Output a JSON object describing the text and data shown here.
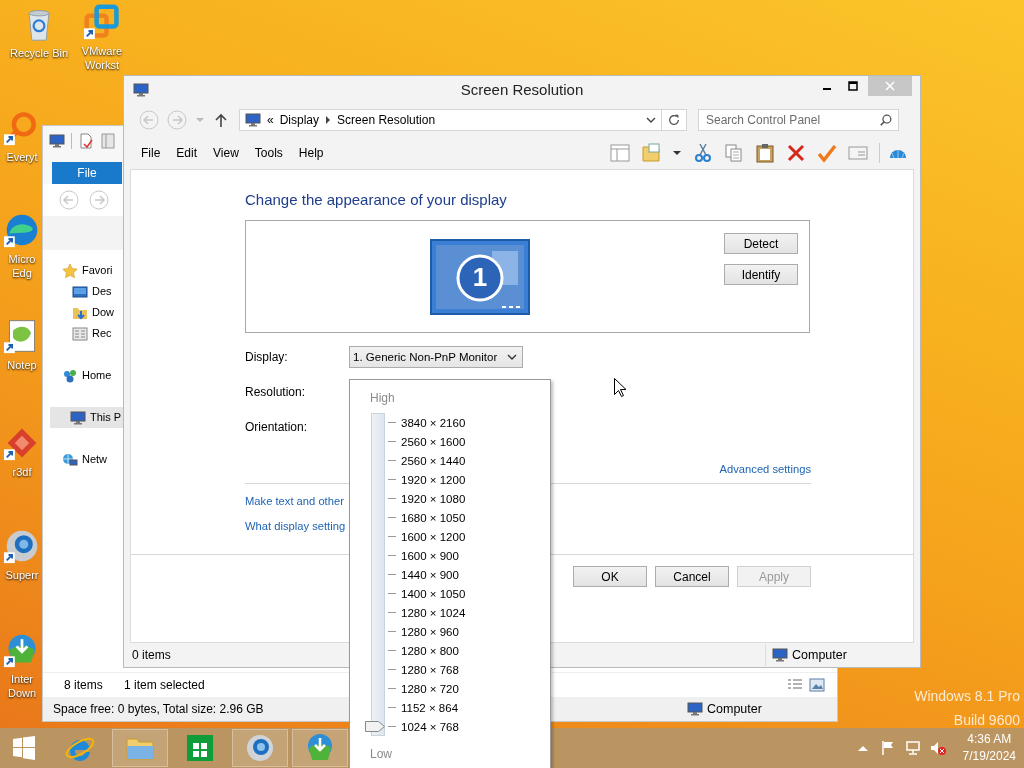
{
  "desktop": {
    "icons": [
      {
        "kind": "recycle-bin",
        "label": "Recycle Bin"
      },
      {
        "kind": "vmware",
        "label": "VMware Workst"
      },
      {
        "kind": "everything",
        "label": "Everyt"
      },
      {
        "kind": "edge",
        "label": "Micro Edg"
      },
      {
        "kind": "notepad",
        "label": "Notep"
      },
      {
        "kind": "r3df",
        "label": "r3df"
      },
      {
        "kind": "supermium",
        "label": "Superr"
      },
      {
        "kind": "idm",
        "label": "Inter Down"
      }
    ],
    "edition": [
      "Windows 8.1 Pro",
      "Build 9600"
    ]
  },
  "explorer_window": {
    "file_tab": "File",
    "nav_pane": [
      {
        "kind": "favorites",
        "label": "Favori",
        "selected": false,
        "children": [
          {
            "kind": "desktop",
            "label": "Des",
            "selected": false
          },
          {
            "kind": "downloads",
            "label": "Dow",
            "selected": false
          },
          {
            "kind": "recent",
            "label": "Rec",
            "selected": false
          }
        ]
      },
      {
        "kind": "homegroup",
        "label": "Home",
        "selected": false
      },
      {
        "kind": "pc",
        "label": "This P",
        "selected": true
      },
      {
        "kind": "network",
        "label": "Netw",
        "selected": false
      }
    ],
    "status": {
      "count": "8 items",
      "selection": "1 item selected",
      "drive_info": "Space free: 0 bytes, Total size: 2.96 GB",
      "location": "Computer"
    }
  },
  "window": {
    "title": "Screen Resolution",
    "address": {
      "overflow": "«",
      "breadcrumb": [
        "Display",
        "Screen Resolution"
      ]
    },
    "search": {
      "placeholder": "Search Control Panel"
    },
    "menu": [
      "File",
      "Edit",
      "View",
      "Tools",
      "Help"
    ],
    "heading": "Change the appearance of your display",
    "monitor": {
      "number": "1"
    },
    "side_buttons": [
      "Detect",
      "Identify"
    ],
    "fields": [
      {
        "label": "Display:",
        "value": "1. Generic Non-PnP Monitor"
      },
      {
        "label": "Resolution:"
      },
      {
        "label": "Orientation:"
      }
    ],
    "advanced_link": "Advanced settings",
    "links": [
      "Make text and other",
      "What display setting"
    ],
    "buttons": [
      {
        "label": "OK",
        "disabled": false
      },
      {
        "label": "Cancel",
        "disabled": false
      },
      {
        "label": "Apply",
        "disabled": true
      }
    ],
    "status": {
      "count": "0 items",
      "location": "Computer"
    }
  },
  "resolution_list": {
    "high": "High",
    "low": "Low",
    "level": 0,
    "options": [
      "3840 × 2160",
      "2560 × 1600",
      "2560 × 1440",
      "1920 × 1200",
      "1920 × 1080",
      "1680 × 1050",
      "1600 × 1200",
      "1600 × 900",
      "1440 × 900",
      "1400 × 1050",
      "1280 × 1024",
      "1280 × 960",
      "1280 × 800",
      "1280 × 768",
      "1280 × 720",
      "1152 × 864",
      "1024 × 768"
    ]
  },
  "taskbar": {
    "apps": [
      {
        "kind": "ie",
        "running": false
      },
      {
        "kind": "explorer",
        "running": true
      },
      {
        "kind": "store",
        "running": false
      },
      {
        "kind": "browser",
        "running": true
      },
      {
        "kind": "idm",
        "running": true
      }
    ],
    "tray": [
      {
        "kind": "chevron"
      },
      {
        "kind": "flag"
      },
      {
        "kind": "network"
      },
      {
        "kind": "volume",
        "muted": true
      }
    ],
    "time": "4:36 AM",
    "date": "7/19/2024"
  }
}
